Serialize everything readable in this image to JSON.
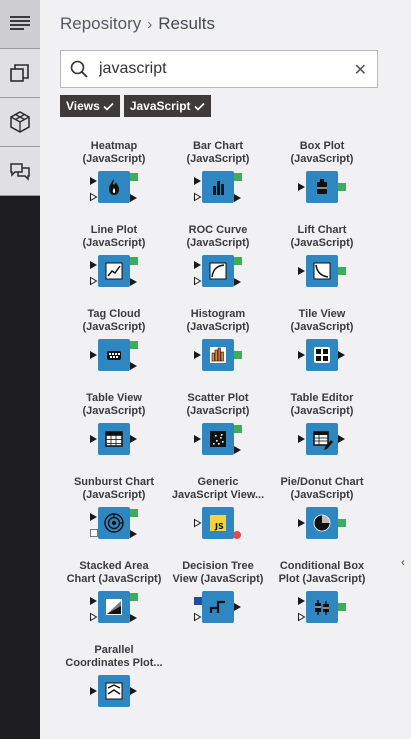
{
  "breadcrumb": {
    "root": "Repository",
    "current": "Results"
  },
  "search": {
    "value": "javascript",
    "placeholder": ""
  },
  "filters": [
    {
      "label": "Views"
    },
    {
      "label": "JavaScript"
    }
  ],
  "nodes": [
    {
      "name1": "Heatmap",
      "name2": "(JavaScript)",
      "icon": "heatmap-icon"
    },
    {
      "name1": "Bar Chart",
      "name2": "(JavaScript)",
      "icon": "bar-chart-icon"
    },
    {
      "name1": "Box Plot",
      "name2": "(JavaScript)",
      "icon": "box-plot-icon"
    },
    {
      "name1": "Line Plot",
      "name2": "(JavaScript)",
      "icon": "line-plot-icon"
    },
    {
      "name1": "ROC Curve",
      "name2": "(JavaScript)",
      "icon": "roc-curve-icon"
    },
    {
      "name1": "Lift Chart",
      "name2": "(JavaScript)",
      "icon": "lift-chart-icon"
    },
    {
      "name1": "Tag Cloud",
      "name2": "(JavaScript)",
      "icon": "tag-cloud-icon"
    },
    {
      "name1": "Histogram",
      "name2": "(JavaScript)",
      "icon": "histogram-icon"
    },
    {
      "name1": "Tile View",
      "name2": "(JavaScript)",
      "icon": "tile-view-icon"
    },
    {
      "name1": "Table View",
      "name2": "(JavaScript)",
      "icon": "table-view-icon"
    },
    {
      "name1": "Scatter Plot",
      "name2": "(JavaScript)",
      "icon": "scatter-plot-icon"
    },
    {
      "name1": "Table Editor",
      "name2": "(JavaScript)",
      "icon": "table-editor-icon"
    },
    {
      "name1": "Sunburst Chart",
      "name2": "(JavaScript)",
      "icon": "sunburst-chart-icon"
    },
    {
      "name1": "Generic",
      "name2": "JavaScript View...",
      "icon": "generic-js-view-icon"
    },
    {
      "name1": "Pie/Donut Chart",
      "name2": "(JavaScript)",
      "icon": "pie-donut-chart-icon"
    },
    {
      "name1": "Stacked Area",
      "name2": "Chart (JavaScript)",
      "icon": "stacked-area-chart-icon"
    },
    {
      "name1": "Decision Tree",
      "name2": "View (JavaScript)",
      "icon": "decision-tree-view-icon"
    },
    {
      "name1": "Conditional Box",
      "name2": "Plot (JavaScript)",
      "icon": "conditional-box-plot-icon"
    },
    {
      "name1": "Parallel",
      "name2": "Coordinates Plot...",
      "icon": "parallel-coordinates-plot-icon"
    }
  ],
  "colors": {
    "node_blue": "#2f87c1",
    "port_green": "#3dad5c",
    "port_red": "#e04c4c",
    "port_dark": "#1a1a1a"
  }
}
